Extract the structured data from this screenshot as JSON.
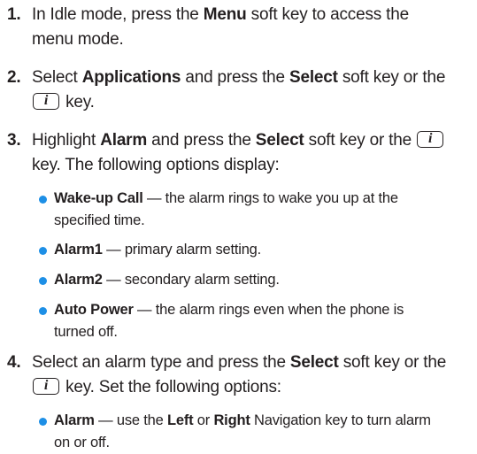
{
  "steps": [
    {
      "number": "1.",
      "line1": {
        "t1": "In Idle mode, press the ",
        "b1": "Menu",
        "t2": " soft key to access the"
      },
      "line2": "menu mode."
    },
    {
      "number": "2.",
      "line1": {
        "t1": "Select ",
        "b1": "Applications",
        "t2": " and press the ",
        "b2": "Select",
        "t3": " soft key or the"
      },
      "line2": " key."
    },
    {
      "number": "3.",
      "line1": {
        "t1": "Highlight ",
        "b1": "Alarm",
        "t2": " and press the ",
        "b2": "Select",
        "t3": " soft key or the "
      },
      "line2": "key. The following options display:",
      "bullets": [
        {
          "label": "Wake-up Call",
          "text": " — the alarm rings to wake you up at the",
          "cont": "specified time."
        },
        {
          "label": "Alarm1",
          "text": " — primary alarm setting."
        },
        {
          "label": "Alarm2",
          "text": " — secondary alarm setting."
        },
        {
          "label": "Auto Power",
          "text": " — the alarm rings even when the phone is",
          "cont": "turned off."
        }
      ]
    },
    {
      "number": "4.",
      "line1": {
        "t1": "Select an alarm type and press the ",
        "b1": "Select",
        "t2": " soft key or the"
      },
      "line2": " key. Set the following options:",
      "bullets": [
        {
          "label": "Alarm",
          "t1": " — use the ",
          "b1": "Left",
          "t2": " or ",
          "b2": "Right",
          "t3": " Navigation key to turn alarm",
          "cont": "on or off."
        }
      ]
    }
  ],
  "icons": {
    "i_key": "i"
  },
  "colors": {
    "bullet": "#1d8fe6",
    "text": "#231f20"
  }
}
